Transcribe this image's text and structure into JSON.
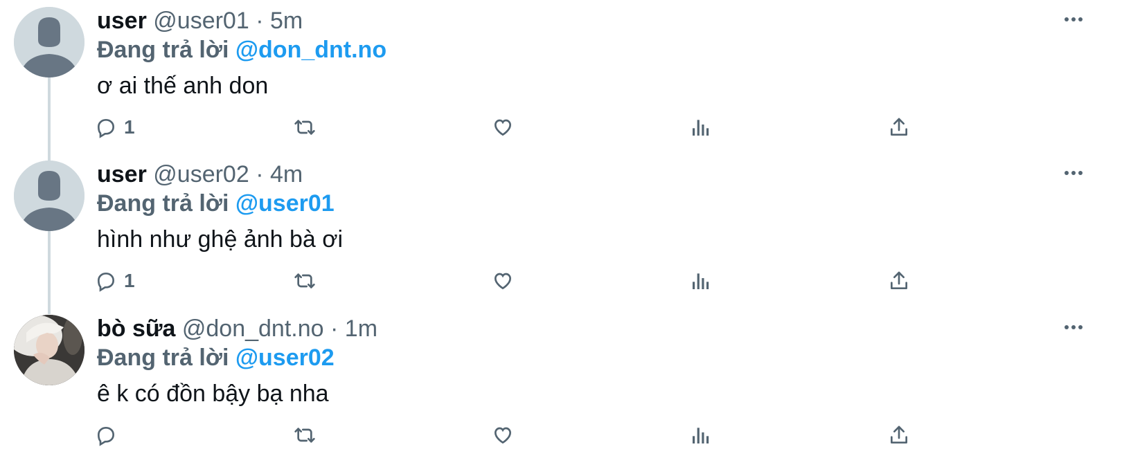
{
  "tweets": [
    {
      "name": "user",
      "handle": "@user01",
      "sep": "·",
      "time": "5m",
      "replying_prefix": "Đang trả lời",
      "replying_to": "@don_dnt.no",
      "text": "ơ ai thế anh don",
      "reply_count": "1",
      "avatar": "default-avatar-icon"
    },
    {
      "name": "user",
      "handle": "@user02",
      "sep": "·",
      "time": "4m",
      "replying_prefix": "Đang trả lời",
      "replying_to": "@user01",
      "text": "hình như ghệ ảnh bà ơi",
      "reply_count": "1",
      "avatar": "default-avatar-icon"
    },
    {
      "name": "bò sữa",
      "handle": "@don_dnt.no",
      "sep": "·",
      "time": "1m",
      "replying_prefix": "Đang trả lời",
      "replying_to": "@user02",
      "text": "ê k có đồn bậy bạ nha",
      "reply_count": "",
      "avatar": "profile-photo"
    }
  ],
  "action_icons": [
    "reply-icon",
    "retweet-icon",
    "like-icon",
    "views-icon",
    "share-icon"
  ],
  "colors": {
    "text": "#0f1419",
    "secondary": "#536471",
    "mention": "#1d9bf0",
    "thread_line": "#cfd9de",
    "avatar_bg": "#cfd9de",
    "avatar_silhouette": "#687684"
  }
}
